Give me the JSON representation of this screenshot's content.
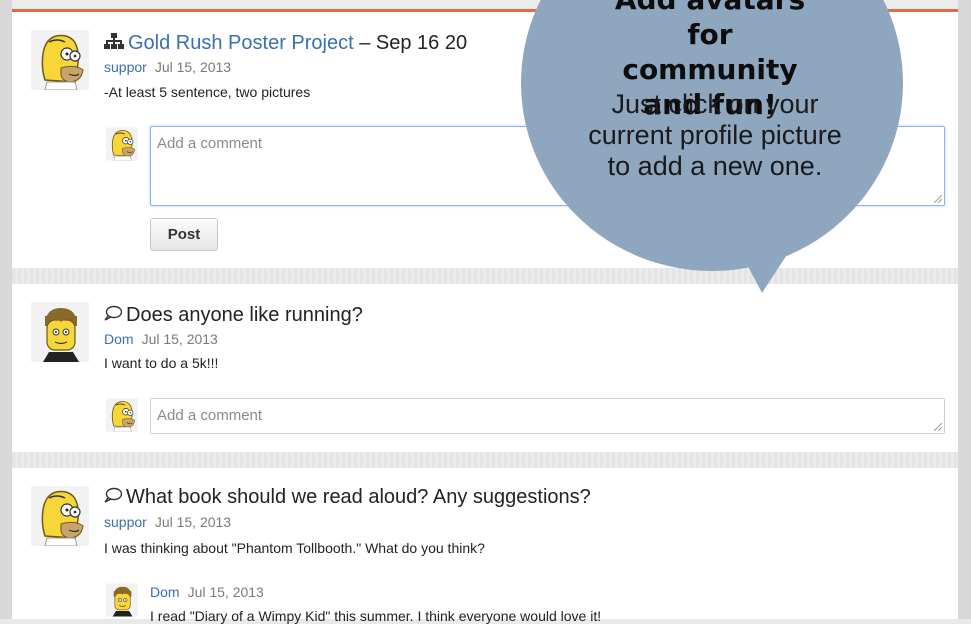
{
  "posts": [
    {
      "type_icon": "org-chart-icon",
      "title_link": "Gold Rush Poster Project",
      "title_rest": " – Sep 16 20",
      "author": "suppor",
      "date": "Jul 15, 2013",
      "body": "-At least 5 sentence, two pictures",
      "comment_placeholder": "Add a comment",
      "post_button": "Post"
    },
    {
      "type_icon": "speech-bubble-icon",
      "title": "Does anyone like running?",
      "author": "Dom",
      "date": "Jul 15, 2013",
      "body": "I want to do a 5k!!!",
      "comment_placeholder": "Add a comment"
    },
    {
      "type_icon": "speech-bubble-icon",
      "title": "What book should we read aloud? Any suggestions?",
      "author": "suppor",
      "date": "Jul 15, 2013",
      "body": "I was thinking about \"Phantom Tollbooth.\" What do you think?",
      "reply": {
        "author": "Dom",
        "date": "Jul 15, 2013",
        "body": "I read \"Diary of a Wimpy Kid\" this summer. I think everyone would love it!"
      }
    }
  ],
  "callout": {
    "heading": "Add avatars\nfor\ncommunity\nand fun!",
    "body": "Just click on your\ncurrent profile picture\nto add a new one."
  },
  "colors": {
    "link": "#3a6fb0",
    "accent": "#e06a4a",
    "callout_fill": "#8fa6bf"
  }
}
